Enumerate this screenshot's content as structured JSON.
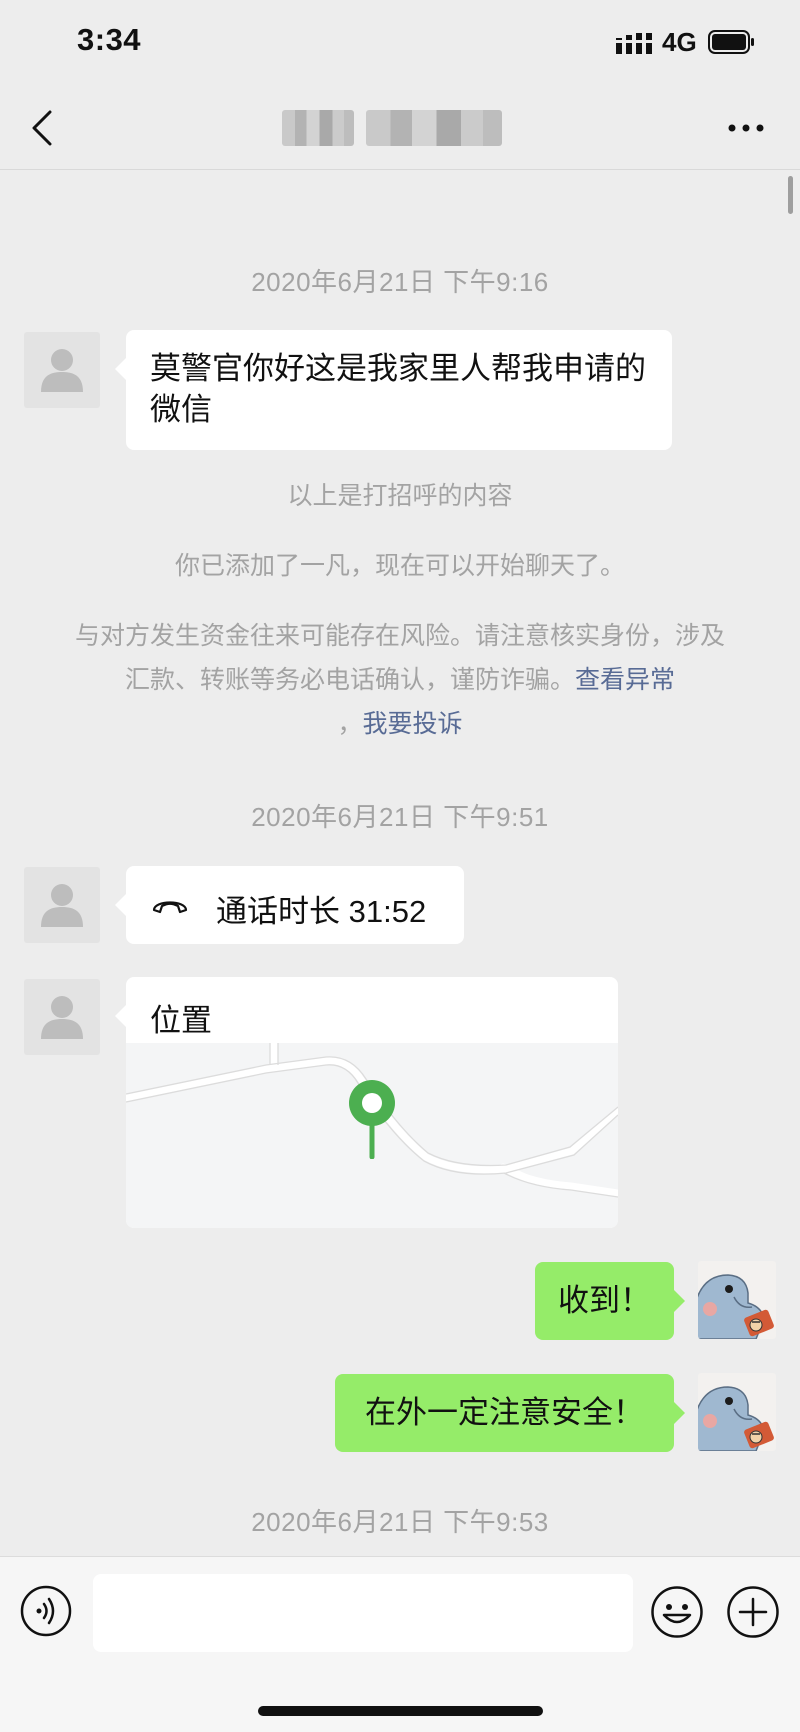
{
  "status_bar": {
    "time": "3:34",
    "network": "4G",
    "icons": [
      "signal-icon",
      "battery-icon"
    ]
  },
  "nav": {
    "icons": [
      "chevron-left-icon",
      "more-icon"
    ]
  },
  "messages": {
    "timestamp_1": "2020年6月21日 下午9:16",
    "msg_1": "莫警官你好这是我家里人帮我申请的微信",
    "system_1": "以上是打招呼的内容",
    "system_2": "你已添加了一凡，现在可以开始聊天了。",
    "warning_text": "与对方发生资金往来可能存在风险。请注意核实身份，涉及汇款、转账等务必电话确认，谨防诈骗。",
    "warning_link_1": "查看异常",
    "warning_sep": "，",
    "warning_link_2": "我要投诉",
    "timestamp_2": "2020年6月21日 下午9:51",
    "call_duration": "通话时长 31:52",
    "location_title": "位置",
    "reply_1": "收到！",
    "reply_2": "在外一定注意安全！",
    "timestamp_3": "2020年6月21日 下午9:53"
  },
  "input_bar": {
    "placeholder": "",
    "icons": [
      "voice-icon",
      "emoji-icon",
      "plus-icon"
    ]
  },
  "colors": {
    "background": "#ededed",
    "sent_bubble": "#95ec69",
    "received_bubble": "#ffffff",
    "link": "#586b95",
    "location_pin": "#4caf50"
  }
}
